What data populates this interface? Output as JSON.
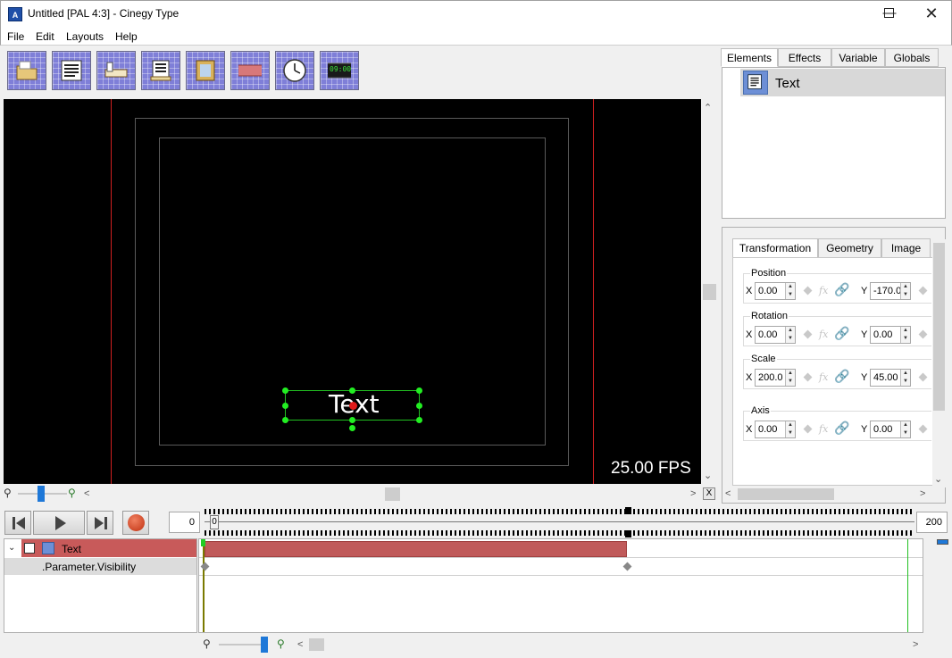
{
  "window": {
    "title": "Untitled [PAL 4:3] - Cinegy Type",
    "icon_letter": "A"
  },
  "menu": [
    "File",
    "Edit",
    "Layouts",
    "Help"
  ],
  "toolbar": {
    "buttons": [
      "open-folder-icon",
      "text-element-icon",
      "ticker-icon",
      "roll-icon",
      "image-element-icon",
      "rectangle-icon",
      "clock-icon",
      "digital-clock-icon"
    ],
    "digital_clock_text": "09:00"
  },
  "canvas": {
    "element_text": "Text",
    "fps": "25.00 FPS"
  },
  "transport": {
    "start_frame": "0",
    "end_frame": "200",
    "ruler_start_label": "0"
  },
  "tracks": {
    "element": "Text",
    "parameter": ".Parameter.Visibility"
  },
  "right_panel": {
    "tabs": [
      "Elements",
      "Effects",
      "Variable",
      "Globals"
    ],
    "active_tab": "Elements",
    "elements": [
      {
        "name": "Text"
      }
    ],
    "prop_tabs": [
      "Transformation",
      "Geometry",
      "Image"
    ],
    "groups": {
      "position": {
        "title": "Position",
        "x": "0.00",
        "y": "-170.0"
      },
      "rotation": {
        "title": "Rotation",
        "x": "0.00",
        "y": "0.00"
      },
      "scale": {
        "title": "Scale",
        "x": "200.0",
        "y": "45.00"
      },
      "axis": {
        "title": "Axis",
        "x": "0.00",
        "y": "0.00"
      }
    },
    "axis_labels": {
      "x": "X",
      "y": "Y"
    },
    "fx_label": "fx"
  },
  "misc": {
    "close_panel_label": "X"
  }
}
